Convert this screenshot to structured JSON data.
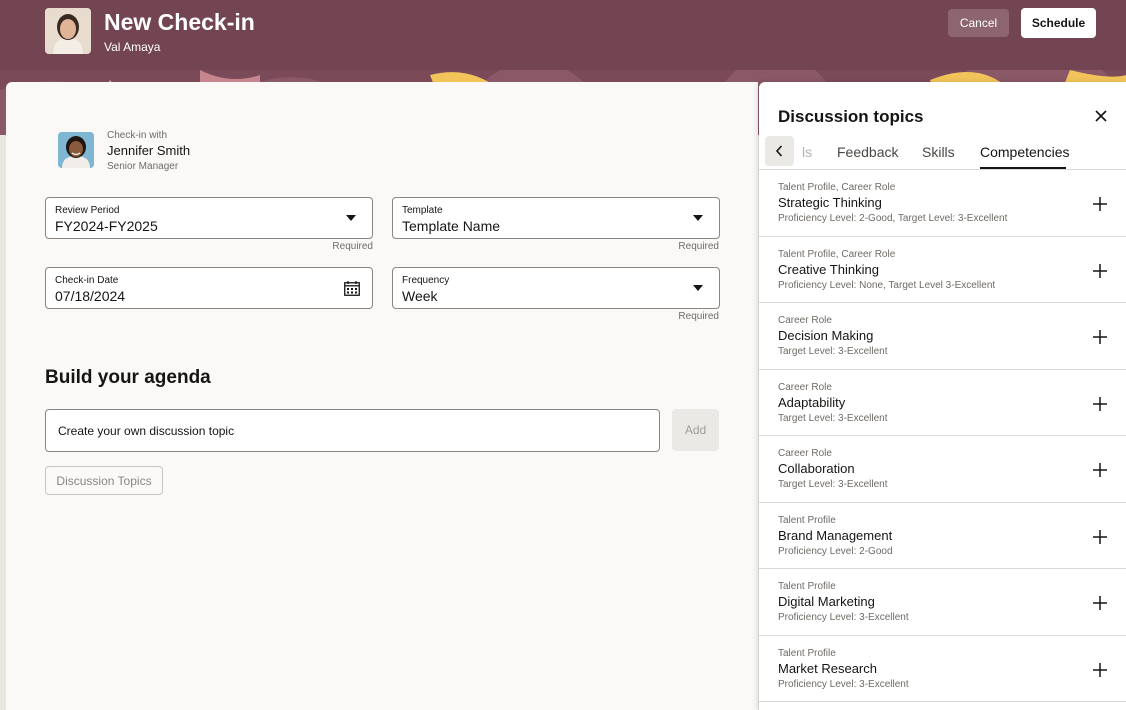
{
  "header": {
    "title": "New Check-in",
    "subtitle": "Val Amaya",
    "cancel_label": "Cancel",
    "schedule_label": "Schedule",
    "color": "#734553"
  },
  "checkin_with": {
    "label": "Check-in with",
    "name": "Jennifer Smith",
    "role": "Senior Manager"
  },
  "form": {
    "review_period": {
      "label": "Review Period",
      "value": "FY2024-FY2025",
      "hint": "Required"
    },
    "template": {
      "label": "Template",
      "value": "Template Name",
      "hint": "Required"
    },
    "checkin_date": {
      "label": "Check-in Date",
      "value": "07/18/2024"
    },
    "frequency": {
      "label": "Frequency",
      "value": "Week",
      "hint": "Required"
    }
  },
  "agenda": {
    "title": "Build your agenda",
    "input_placeholder": "Create your own discussion topic",
    "add_label": "Add",
    "topics_button_label": "Discussion Topics"
  },
  "side_panel": {
    "title": "Discussion topics",
    "tabs": [
      {
        "label": "ls",
        "state": "faded"
      },
      {
        "label": "Feedback",
        "state": "normal"
      },
      {
        "label": "Skills",
        "state": "normal"
      },
      {
        "label": "Competencies",
        "state": "active"
      }
    ],
    "items": [
      {
        "source": "Talent Profile, Career Role",
        "name": "Strategic Thinking",
        "level": "Proficiency Level: 2-Good, Target Level: 3-Excellent"
      },
      {
        "source": "Talent Profile, Career Role",
        "name": "Creative Thinking",
        "level": "Proficiency Level: None, Target Level 3-Excellent"
      },
      {
        "source": "Career Role",
        "name": "Decision Making",
        "level": "Target Level: 3-Excellent"
      },
      {
        "source": "Career Role",
        "name": "Adaptability",
        "level": "Target Level: 3-Excellent"
      },
      {
        "source": "Career Role",
        "name": "Collaboration",
        "level": "Target Level: 3-Excellent"
      },
      {
        "source": "Talent Profile",
        "name": "Brand Management",
        "level": "Proficiency Level: 2-Good"
      },
      {
        "source": "Talent Profile",
        "name": "Digital Marketing",
        "level": "Proficiency Level: 3-Excellent"
      },
      {
        "source": "Talent Profile",
        "name": "Market Research",
        "level": "Proficiency Level: 3-Excellent"
      }
    ]
  }
}
